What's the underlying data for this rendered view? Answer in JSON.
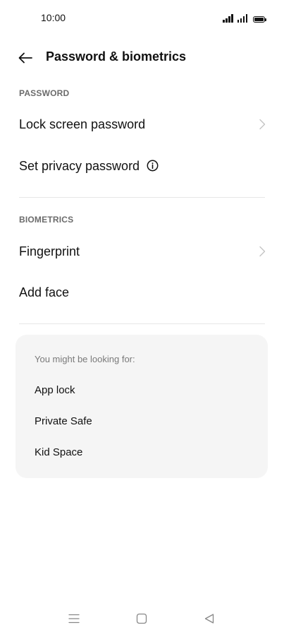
{
  "status_bar": {
    "time": "10:00"
  },
  "header": {
    "back_icon": "arrow-left-icon",
    "title": "Password & biometrics"
  },
  "password_section": {
    "header": "PASSWORD",
    "items": [
      {
        "label": "Lock screen password",
        "icon": "chevron-right-icon"
      },
      {
        "label": "Set privacy password",
        "icon": "info-icon"
      }
    ]
  },
  "biometrics_section": {
    "header": "BIOMETRICS",
    "items": [
      {
        "label": "Fingerprint",
        "icon": "chevron-right-icon"
      },
      {
        "label": "Add face"
      }
    ]
  },
  "suggestions": {
    "title": "You might be looking for:",
    "items": [
      "App lock",
      "Private Safe",
      "Kid Space"
    ]
  },
  "nav_bar": {
    "icons": [
      "menu-icon",
      "home-icon",
      "back-triangle-icon"
    ]
  },
  "colors": {
    "text": "#111111",
    "section_header": "#6b6b6b",
    "card_background": "#f5f5f5",
    "divider": "#e6e6e6",
    "chevron": "#c4c4c4"
  }
}
